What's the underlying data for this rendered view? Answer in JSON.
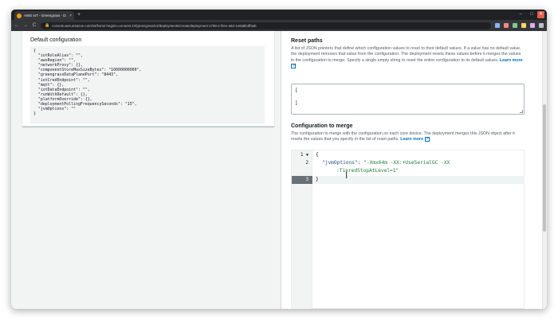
{
  "browser": {
    "tab_title": "AWS IoT - Greengrass - D...",
    "tab_close": "×",
    "new_tab": "+",
    "url": "console.aws.amazon.com/iot/home?region=us-west-1#/greengrass/v2/deployments/create/deployment-1788-4-f2ee-a53-1e8a8b4ff4ab",
    "back": "←",
    "forward": "→",
    "reload": "C",
    "lock": "🔒",
    "window_close": "✕",
    "window_min": "–",
    "window_max": "□"
  },
  "left": {
    "title": "Default configuration",
    "json_lines": [
      "{",
      "  \"iotRoleAlias\": \"\",",
      "  \"awsRegion\": \"\",",
      "  \"networkProxy\": {},",
      "  \"componentStoreMaxSizeBytes\": \"10000000000\",",
      "  \"greengrassDataPlanePort\": \"8443\",",
      "  \"iotCredEndpoint\": \"\",",
      "  \"mqtt\": {},",
      "  \"iotDataEndpoint\": \"\",",
      "  \"runWithDefault\": {},",
      "  \"platformOverride\": {},",
      "  \"deploymentPollingFrequencySeconds\": \"15\",",
      "  \"jvmOptions\": \"\"",
      "}"
    ]
  },
  "reset": {
    "title": "Reset paths",
    "description": "A list of JSON pointers that define which configuration values to reset to their default values. If a value has no default value, the deployment removes that value from the configuration. The deployment resets these values before it merges the values in the configuration to merge. Specify a single empty string to reset the entire configuration to its default values.",
    "learn_more": "Learn more",
    "textarea_lines": [
      "[",
      "",
      "]"
    ]
  },
  "merge": {
    "title": "Configuration to merge",
    "description": "The configuration to merge with the configuration on each core device. The deployment merges this JSON object after it resets the values that you specify in the list of reset paths.",
    "learn_more": "Learn more",
    "gutter": [
      "1",
      "2",
      "",
      "3"
    ],
    "fold_marker": "▼",
    "code": {
      "open": "{",
      "key": "\"jvmOptions\"",
      "colon": ": ",
      "value_part1": "\"-Xmx64m -XX:+UseSerialGC -XX",
      "value_part2": ":TieredStopAtLevel=1\"",
      "close": "}"
    }
  },
  "colors": {
    "link": "#0073bb",
    "json_key": "#1d4e89",
    "json_string": "#1e7c3a",
    "active_gutter": "#687078"
  }
}
